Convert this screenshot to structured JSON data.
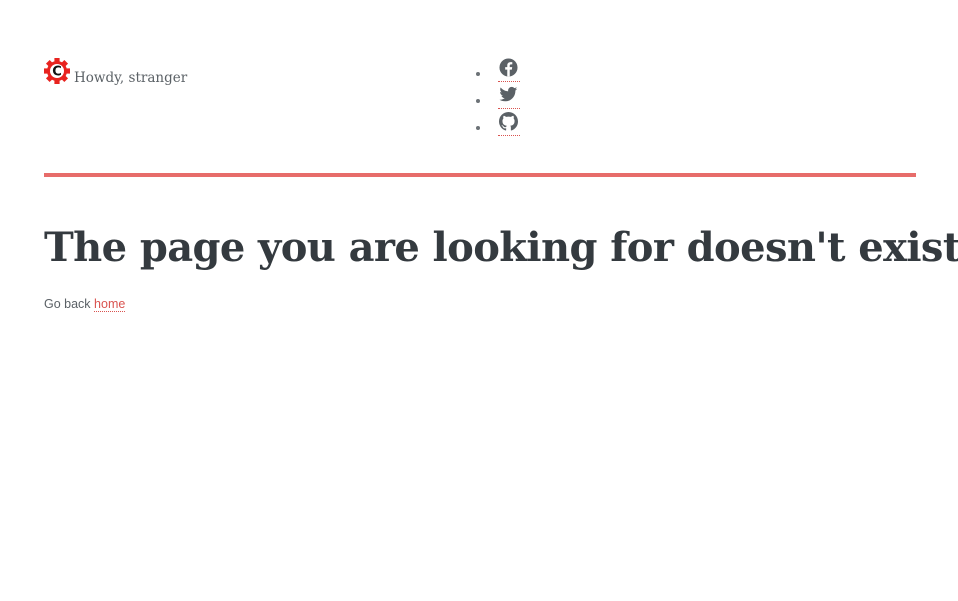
{
  "header": {
    "greeting": "Howdy, stranger",
    "logo_letter": "C",
    "social": [
      {
        "name": "facebook",
        "icon": "facebook-icon"
      },
      {
        "name": "twitter",
        "icon": "twitter-icon"
      },
      {
        "name": "github",
        "icon": "github-icon"
      }
    ]
  },
  "main": {
    "title": "The page you are looking for doesn't exist.",
    "goback_prefix": "Go back",
    "home_link": "home"
  },
  "colors": {
    "accent": "#e76c6a",
    "link": "#d9534f",
    "logo": "#e8231f",
    "text": "#343a3f",
    "icon": "#5b6166"
  }
}
